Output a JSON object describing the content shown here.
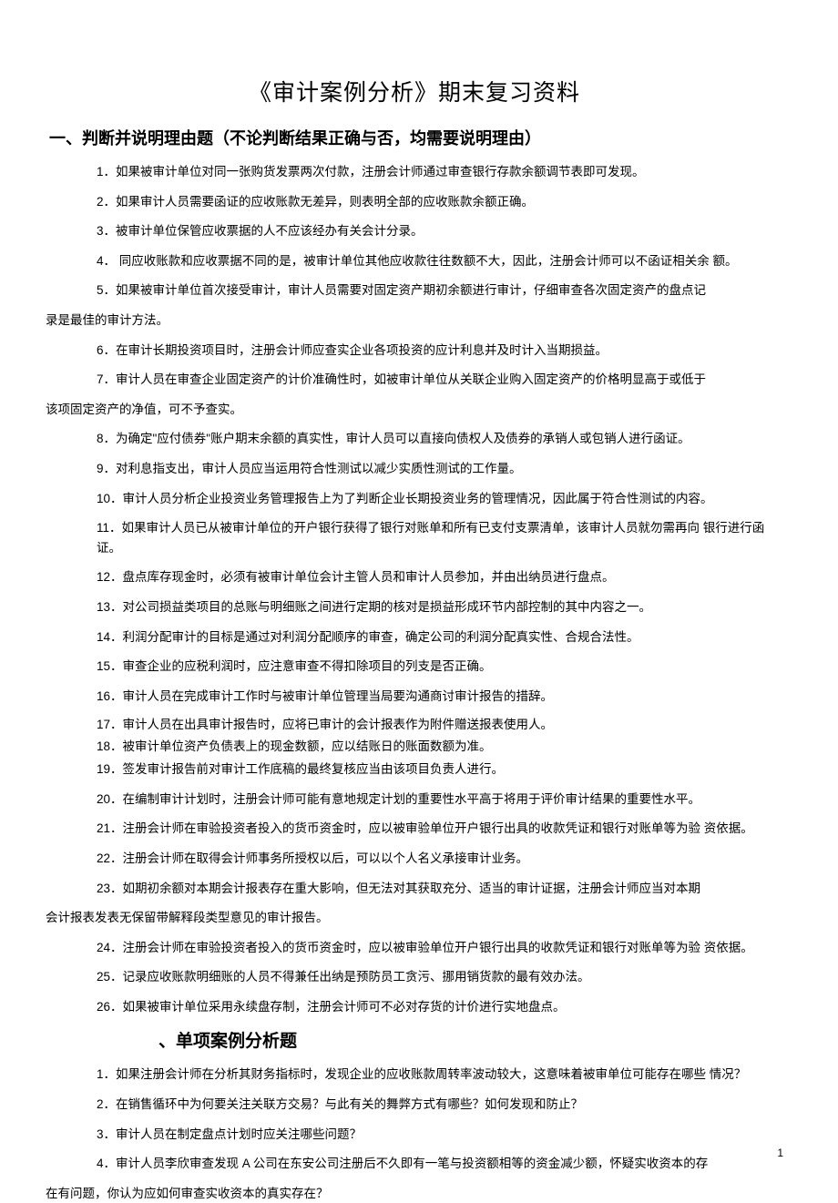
{
  "title": "《审计案例分析》期末复习资料",
  "sections": {
    "s1": {
      "heading": "一、判断并说明理由题（不论判断结果正确与否，均需要说明理由）",
      "items": {
        "i1": "1．如果被审计单位对同一张购货发票两次付款，注册会计师通过审查银行存款余额调节表即可发现。",
        "i2": "2．如果审计人员需要函证的应收账款无差异，则表明全部的应收账款余额正确。",
        "i3": "3．被审计单位保管应收票据的人不应该经办有关会计分录。",
        "i4": "4． 同应收账款和应收票据不同的是，被审计单位其他应收款往往数额不大，因此，注册会计师可以不函证相关余 额。",
        "i5a": "5．如果被审计单位首次接受审计，审计人员需要对固定资产期初余额进行审计，仔细审查各次固定资产的盘点记",
        "i5b": "录是最佳的审计方法。",
        "i6": "6．在审计长期投资项目时，注册会计师应查实企业各项投资的应计利息并及时计入当期损益。",
        "i7a": "7．审计人员在审查企业固定资产的计价准确性时，如被审计单位从关联企业购入固定资产的价格明显高于或低于",
        "i7b": "该项固定资产的净值，可不予查实。",
        "i8": "8．为确定\"应付债券\"账户期末余额的真实性，审计人员可以直接向债权人及债券的承销人或包销人进行函证。",
        "i9": "9．对利息指支出，审计人员应当运用符合性测试以减少实质性测试的工作量。",
        "i10": "10．审计人员分析企业投资业务管理报告上为了判断企业长期投资业务的管理情况，因此属于符合性测试的内容。",
        "i11": "11．如果审计人员已从被审计单位的开户银行获得了银行对账单和所有已支付支票清单，该审计人员就勿需再向 银行进行函证。",
        "i12": "12．盘点库存现金时，必须有被审计单位会计主管人员和审计人员参加，并由出纳员进行盘点。",
        "i13": "13．对公司损益类项目的总账与明细账之间进行定期的核对是损益形成环节内部控制的其中内容之一。",
        "i14": "14．利润分配审计的目标是通过对利润分配顺序的审查，确定公司的利润分配真实性、合规合法性。",
        "i15": "15．审查企业的应税利润时，应注意审查不得扣除项目的列支是否正确。",
        "i16": "16．审计人员在完成审计工作时与被审计单位管理当局要沟通商讨审计报告的措辞。",
        "i17": "17．审计人员在出具审计报告时，应将已审计的会计报表作为附件赠送报表使用人。",
        "i18": "18．被审计单位资产负债表上的现金数额，应以结账日的账面数额为准。",
        "i19": "19．签发审计报告前对审计工作底稿的最终复核应当由该项目负责人进行。",
        "i20": "20．在编制审计计划时，注册会计师可能有意地规定计划的重要性水平高于将用于评价审计结果的重要性水平。",
        "i21": "21．注册会计师在审验投资者投入的货币资金时，应以被审验单位开户银行出具的收款凭证和银行对账单等为验 资依据。",
        "i22": "22．注册会计师在取得会计师事务所授权以后，可以以个人名义承接审计业务。",
        "i23a": "23．如期初余额对本期会计报表存在重大影响，但无法对其获取充分、适当的审计证据，注册会计师应当对本期",
        "i23b": "会计报表发表无保留带解释段类型意见的审计报告。",
        "i24": "24．注册会计师在审验投资者投入的货币资金时，应以被审验单位开户银行出具的收款凭证和银行对账单等为验 资依据。",
        "i25": "25．记录应收账款明细账的人员不得兼任出纳是预防员工贪污、挪用销货款的最有效办法。",
        "i26": "26．如果被审计单位采用永续盘存制，注册会计师可不必对存货的计价进行实地盘点。"
      }
    },
    "s2": {
      "heading": "、单项案例分析题",
      "items": {
        "i1": "1．如果注册会计师在分析其财务指标时，发现企业的应收账款周转率波动较大，这意味着被审单位可能存在哪些 情况？",
        "i2": "2．在销售循环中为何要关注关联方交易？与此有关的舞弊方式有哪些？如何发现和防止？",
        "i3": "3．审计人员在制定盘点计划时应关注哪些问题？",
        "i4a": "4．审计人员李欣审查发现 A 公司在东安公司注册后不久即有一笔与投资额相等的资金减少额，怀疑实收资本的存",
        "i4b": "在有问题，你认为应如何审查实收资本的真实存在？"
      }
    }
  },
  "pageNumber": "1"
}
